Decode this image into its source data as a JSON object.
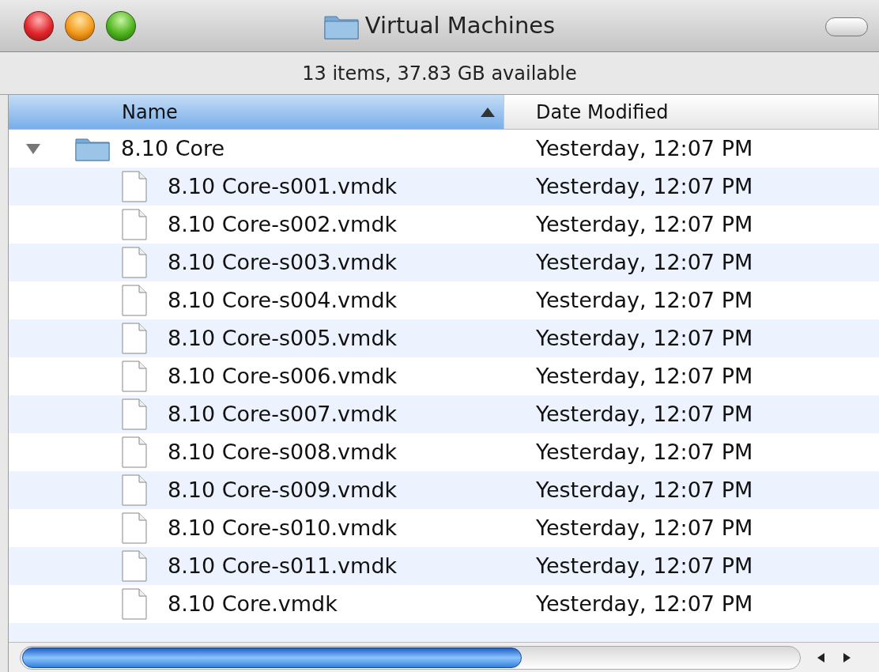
{
  "window": {
    "title": "Virtual Machines"
  },
  "status_text": "13 items, 37.83 GB available",
  "columns": [
    {
      "label": "Name",
      "selected": true,
      "sort_ascending": true
    },
    {
      "label": "Date Modified",
      "selected": false
    }
  ],
  "rows": [
    {
      "kind": "folder",
      "name": "8.10 Core",
      "date": "Yesterday, 12:07 PM",
      "expanded": true,
      "children": [
        {
          "kind": "file",
          "name": "8.10 Core-s001.vmdk",
          "date": "Yesterday, 12:07 PM"
        },
        {
          "kind": "file",
          "name": "8.10 Core-s002.vmdk",
          "date": "Yesterday, 12:07 PM"
        },
        {
          "kind": "file",
          "name": "8.10 Core-s003.vmdk",
          "date": "Yesterday, 12:07 PM"
        },
        {
          "kind": "file",
          "name": "8.10 Core-s004.vmdk",
          "date": "Yesterday, 12:07 PM"
        },
        {
          "kind": "file",
          "name": "8.10 Core-s005.vmdk",
          "date": "Yesterday, 12:07 PM"
        },
        {
          "kind": "file",
          "name": "8.10 Core-s006.vmdk",
          "date": "Yesterday, 12:07 PM"
        },
        {
          "kind": "file",
          "name": "8.10 Core-s007.vmdk",
          "date": "Yesterday, 12:07 PM"
        },
        {
          "kind": "file",
          "name": "8.10 Core-s008.vmdk",
          "date": "Yesterday, 12:07 PM"
        },
        {
          "kind": "file",
          "name": "8.10 Core-s009.vmdk",
          "date": "Yesterday, 12:07 PM"
        },
        {
          "kind": "file",
          "name": "8.10 Core-s010.vmdk",
          "date": "Yesterday, 12:07 PM"
        },
        {
          "kind": "file",
          "name": "8.10 Core-s011.vmdk",
          "date": "Yesterday, 12:07 PM"
        },
        {
          "kind": "file",
          "name": "8.10 Core.vmdk",
          "date": "Yesterday, 12:07 PM"
        }
      ]
    }
  ]
}
